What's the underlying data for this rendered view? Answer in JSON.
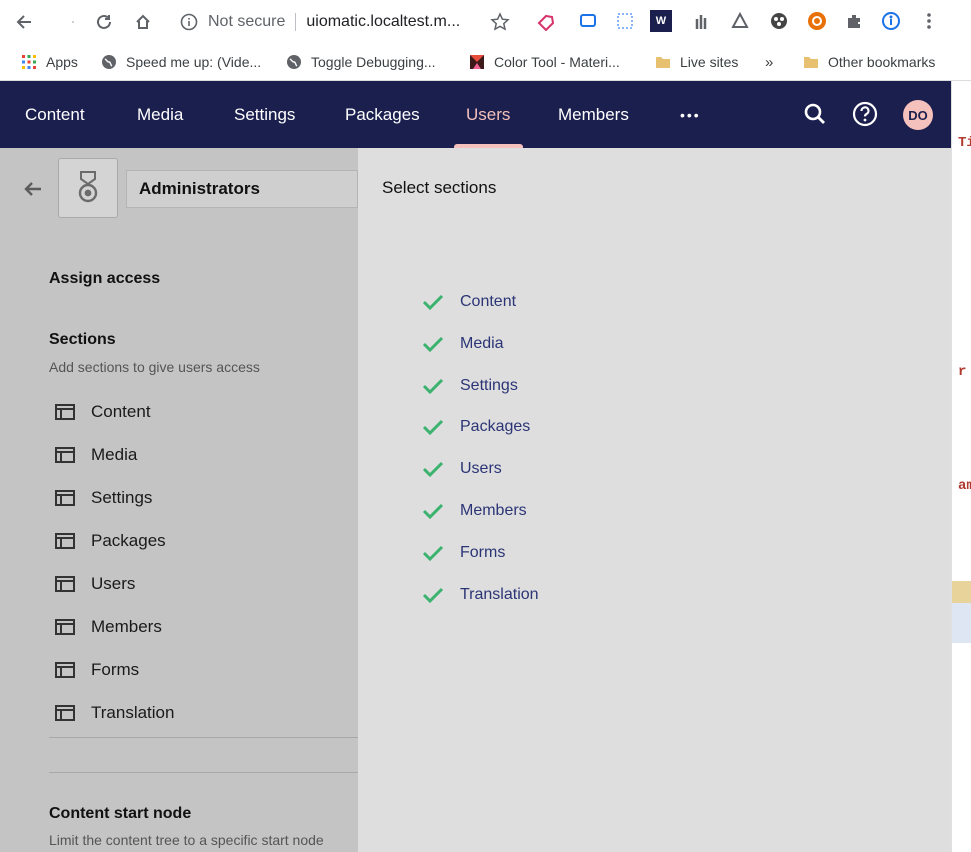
{
  "browser": {
    "security_label": "Not secure",
    "url": "uiomatic.localtest.m...",
    "bookmarks": [
      {
        "label": "Apps",
        "icon": "apps-grid-icon"
      },
      {
        "label": "Speed me up: (Vide...",
        "icon": "globe-icon"
      },
      {
        "label": "Toggle Debugging...",
        "icon": "globe-icon"
      },
      {
        "label": "Color Tool - Materi...",
        "icon": "color-tool-icon"
      },
      {
        "label": "Live sites",
        "icon": "folder-icon"
      }
    ],
    "bookmarks_overflow": "»",
    "other_bookmarks": "Other bookmarks"
  },
  "header": {
    "nav": [
      {
        "label": "Content",
        "active": false
      },
      {
        "label": "Media",
        "active": false
      },
      {
        "label": "Settings",
        "active": false
      },
      {
        "label": "Packages",
        "active": false
      },
      {
        "label": "Users",
        "active": true
      },
      {
        "label": "Members",
        "active": false
      }
    ],
    "more": "•••",
    "avatar_initials": "DO",
    "colors": {
      "background": "#1b1f4e",
      "active": "#f5c1bc",
      "text": "#ffffff"
    }
  },
  "left_panel": {
    "group_name": "Administrators",
    "assign_access": "Assign access",
    "sections_title": "Sections",
    "sections_desc": "Add sections to give users access",
    "sections": [
      "Content",
      "Media",
      "Settings",
      "Packages",
      "Users",
      "Members",
      "Forms",
      "Translation"
    ],
    "content_start_title": "Content start node",
    "content_start_desc": "Limit the content tree to a specific start node"
  },
  "dialog": {
    "title": "Select sections",
    "items": [
      "Content",
      "Media",
      "Settings",
      "Packages",
      "Users",
      "Members",
      "Forms",
      "Translation"
    ],
    "check_color": "#3bb36e"
  },
  "editor_strip": {
    "snippets": [
      "Ti",
      "r",
      "am"
    ]
  }
}
